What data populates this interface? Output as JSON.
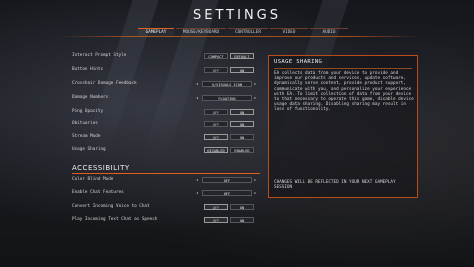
{
  "title": "SETTINGS",
  "tabs": [
    "GAMEPLAY",
    "MOUSE/KEYBOARD",
    "CONTROLLER",
    "VIDEO",
    "AUDIO"
  ],
  "settings": [
    {
      "label": "Interact Prompt Style",
      "options": [
        "COMPACT",
        "DEFAULT"
      ]
    },
    {
      "label": "Button Hints",
      "options": [
        "OFF",
        "ON"
      ]
    },
    {
      "label": "Crosshair Damage Feedback",
      "value": "X/VISUALS ICON"
    },
    {
      "label": "Damage Numbers",
      "value": "FLOATING"
    },
    {
      "label": "Ping Opacity",
      "options": [
        "OFF",
        "ON"
      ]
    },
    {
      "label": "Obituaries",
      "options": [
        "OFF",
        "ON"
      ]
    },
    {
      "label": "Stream Mode",
      "options": [
        "OFF",
        "ON"
      ]
    },
    {
      "label": "Usage Sharing",
      "options": [
        "DISABLED",
        "ENABLED"
      ]
    }
  ],
  "accessibility": {
    "heading": "ACCESSIBILITY",
    "items": [
      {
        "label": "Color Blind Mode",
        "value": "OFF"
      },
      {
        "label": "Enable Chat Features",
        "value": "OFF"
      },
      {
        "label": "Convert Incoming Voice to Chat",
        "options": [
          "OFF",
          "ON"
        ]
      },
      {
        "label": "Play Incoming Text Chat as Speech",
        "options": [
          "OFF",
          "ON"
        ]
      }
    ]
  },
  "panel": {
    "title": "USAGE SHARING",
    "body": "EA collects data from your device to provide and improve our products and services, update software, dynamically serve content, provide product support, communicate with you, and personalize your experience with EA. To limit collection of data from your device to that necessary to operate this game, disable device usage data sharing. Disabling sharing may result in loss of functionality.",
    "note": "CHANGES WILL BE REFLECTED IN YOUR NEXT GAMEPLAY SESSION"
  },
  "colors": {
    "accent": "#e15f1a",
    "panel_border": "#b94c17"
  }
}
